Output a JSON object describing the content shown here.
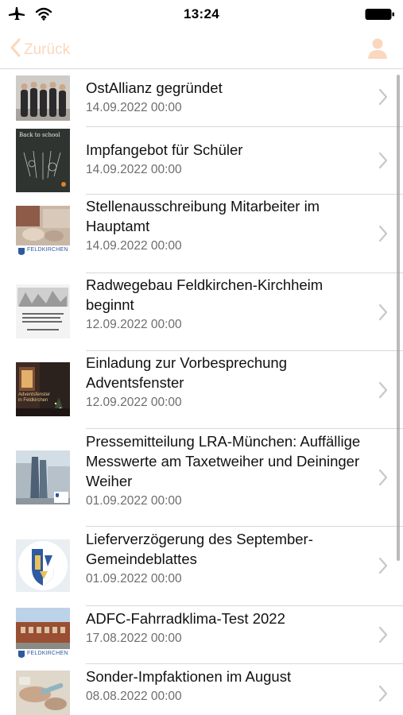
{
  "status": {
    "time": "13:24"
  },
  "nav": {
    "back_label": "Zurück"
  },
  "news": [
    {
      "title": "OstAllianz gegründet",
      "date": "14.09.2022 00:00"
    },
    {
      "title": "Impfangebot für Schüler",
      "date": "14.09.2022 00:00"
    },
    {
      "title": "Stellenausschreibung Mitarbeiter im Hauptamt",
      "date": "14.09.2022 00:00"
    },
    {
      "title": "Radwegebau Feldkirchen-Kirchheim beginnt",
      "date": "12.09.2022 00:00"
    },
    {
      "title": "Einladung zur Vorbesprechung Adventsfenster",
      "date": "12.09.2022 00:00"
    },
    {
      "title": "Pressemitteilung LRA-München: Auffällige Messwerte am Taxetweiher und Deininger Weiher",
      "date": "01.09.2022 00:00"
    },
    {
      "title": "Lieferverzögerung des September-Gemeindeblattes",
      "date": "01.09.2022 00:00"
    },
    {
      "title": "ADFC-Fahrradklima-Test 2022",
      "date": "17.08.2022 00:00"
    },
    {
      "title": "Sonder-Impfaktionen im August",
      "date": "08.08.2022 00:00"
    }
  ],
  "thumb_captions": {
    "impf": "Back to school",
    "feldkirchen": "FELDKIRCHEN",
    "advent": "Adventsfenster in Feldkirchen"
  },
  "colors": {
    "accent": "#fad7bd",
    "separator": "#d8d8d8",
    "date_text": "#6d6d6d"
  },
  "icons": {
    "status": [
      "airplane-icon",
      "wifi-icon",
      "battery-icon"
    ],
    "nav": [
      "chevron-left-icon",
      "user-icon"
    ],
    "row": "chevron-right-icon"
  }
}
